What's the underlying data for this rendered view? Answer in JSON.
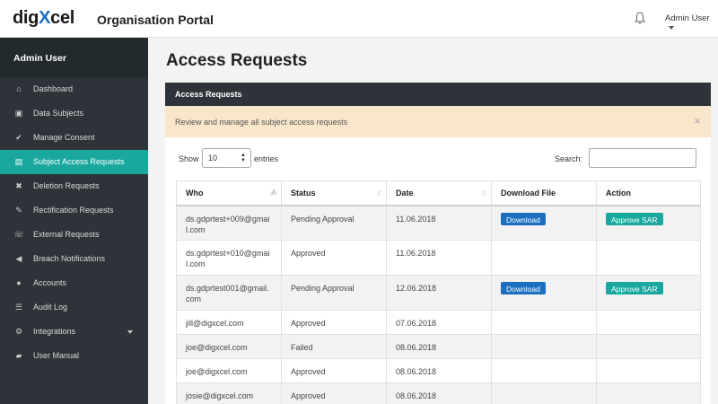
{
  "header": {
    "logo_prefix": "dig",
    "logo_x": "X",
    "logo_suffix": "cel",
    "portal_title": "Organisation Portal",
    "user_menu": "Admin User"
  },
  "sidebar": {
    "title": "Admin User",
    "items": [
      {
        "label": "Dashboard",
        "icon": "home-icon",
        "glyph": "⌂"
      },
      {
        "label": "Data Subjects",
        "icon": "lock-icon",
        "glyph": "▣"
      },
      {
        "label": "Manage Consent",
        "icon": "check-icon",
        "glyph": "✔"
      },
      {
        "label": "Subject Access Requests",
        "icon": "id-card-icon",
        "glyph": "▤",
        "active": true
      },
      {
        "label": "Deletion Requests",
        "icon": "user-remove-icon",
        "glyph": "✖"
      },
      {
        "label": "Rectification Requests",
        "icon": "pencil-icon",
        "glyph": "✎"
      },
      {
        "label": "External Requests",
        "icon": "phone-icon",
        "glyph": "☏"
      },
      {
        "label": "Breach Notifications",
        "icon": "bullhorn-icon",
        "glyph": "◀"
      },
      {
        "label": "Accounts",
        "icon": "user-icon",
        "glyph": "●"
      },
      {
        "label": "Audit Log",
        "icon": "list-icon",
        "glyph": "☰"
      },
      {
        "label": "Integrations",
        "icon": "cogs-icon",
        "glyph": "⚙"
      },
      {
        "label": "User Manual",
        "icon": "book-icon",
        "glyph": "▰"
      }
    ]
  },
  "main": {
    "page_title": "Access Requests",
    "panel_title": "Access Requests",
    "info_text": "Review and manage all subject access requests",
    "close_glyph": "×",
    "show_label": "Show",
    "show_value": "10",
    "entries_label": "entries",
    "search_label": "Search:",
    "search_value": ""
  },
  "table": {
    "columns": [
      "Who",
      "Status",
      "Date",
      "Download File",
      "Action"
    ],
    "rows": [
      {
        "who": "ds.gdprtest+009@gmai\nl.com",
        "status": "Pending Approval",
        "date": "11.06.2018",
        "download": "Download",
        "action": "Approve SAR"
      },
      {
        "who": "ds.gdprtest+010@gmai\nl.com",
        "status": "Approved",
        "date": "11.06.2018",
        "download": "",
        "action": ""
      },
      {
        "who": "ds.gdprtest001@gmail.\ncom",
        "status": "Pending Approval",
        "date": "12.06.2018",
        "download": "Download",
        "action": "Approve SAR"
      },
      {
        "who": "jill@digxcel.com",
        "status": "Approved",
        "date": "07.06.2018",
        "download": "",
        "action": ""
      },
      {
        "who": "joe@digxcel.com",
        "status": "Failed",
        "date": "08.06.2018",
        "download": "",
        "action": ""
      },
      {
        "who": "joe@digxcel.com",
        "status": "Approved",
        "date": "08.06.2018",
        "download": "",
        "action": ""
      },
      {
        "who": "josie@digxcel.com",
        "status": "Approved",
        "date": "08.06.2018",
        "download": "",
        "action": ""
      }
    ]
  },
  "colors": {
    "accent": "#1aa89e",
    "brand_blue": "#1c6fc0",
    "sidebar_bg": "#2d3338",
    "info_bg": "#fae6cb"
  }
}
